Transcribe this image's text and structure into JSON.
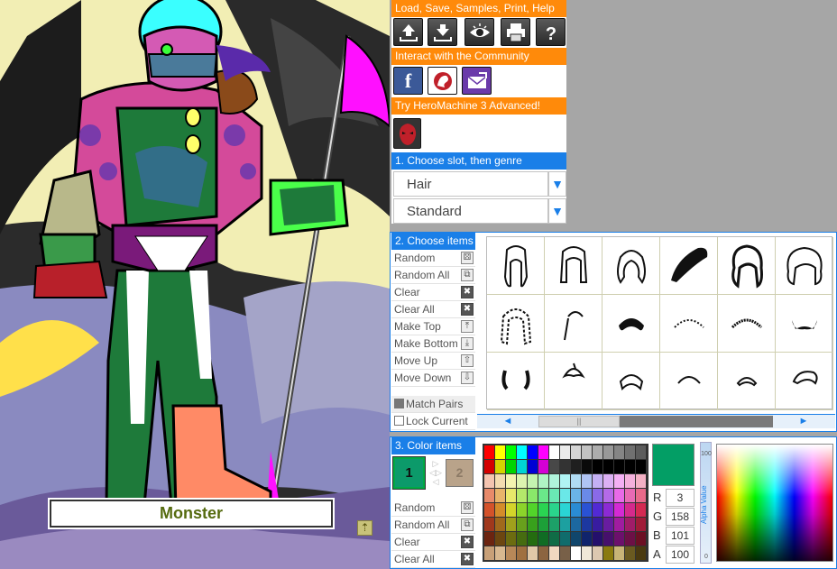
{
  "canvas": {
    "character_name": "Monster",
    "up_arrow_icon": "up-arrow-icon"
  },
  "menu": {
    "header_file": "Load, Save, Samples, Print, Help",
    "file_buttons": [
      {
        "name": "load-icon"
      },
      {
        "name": "save-icon"
      },
      {
        "name": "eye-icon"
      },
      {
        "name": "print-icon"
      },
      {
        "name": "help-icon"
      }
    ],
    "header_community": "Interact with the Community",
    "community_buttons": [
      {
        "name": "facebook-icon",
        "glyph": "f"
      },
      {
        "name": "heromachine-logo-icon"
      },
      {
        "name": "email-icon"
      }
    ],
    "header_advanced": "Try HeroMachine 3 Advanced!",
    "advanced_button": {
      "name": "heromachine3-icon"
    }
  },
  "slot_genre": {
    "header": "1. Choose slot, then genre",
    "slot_value": "Hair",
    "genre_value": "Standard",
    "arrow_glyph": "▼"
  },
  "items": {
    "header": "2. Choose items",
    "actions": [
      {
        "label": "Random",
        "icon": "dice-icon",
        "glyph": "⚄"
      },
      {
        "label": "Random All",
        "icon": "multi-dice-icon",
        "glyph": "⧉"
      },
      {
        "label": "Clear",
        "icon": "clear-icon",
        "glyph": "✖"
      },
      {
        "label": "Clear All",
        "icon": "clear-all-icon",
        "glyph": "✖"
      },
      {
        "label": "Make Top",
        "icon": "make-top-icon",
        "glyph": "⤒"
      },
      {
        "label": "Make Bottom",
        "icon": "make-bottom-icon",
        "glyph": "⤓"
      },
      {
        "label": "Move Up",
        "icon": "move-up-icon",
        "glyph": "⇧"
      },
      {
        "label": "Move Down",
        "icon": "move-down-icon",
        "glyph": "⇩"
      }
    ],
    "match_pairs": "Match Pairs",
    "lock_current": "Lock Current",
    "scroll_left": "◄",
    "scroll_right": "►",
    "scroll_grip": "||"
  },
  "colors": {
    "header": "3. Color items",
    "slot1": "1",
    "slot2": "2",
    "actions": [
      {
        "label": "Random",
        "icon": "dice-icon",
        "glyph": "⚄"
      },
      {
        "label": "Random All",
        "icon": "multi-dice-icon",
        "glyph": "⧉"
      },
      {
        "label": "Clear",
        "icon": "clear-icon",
        "glyph": "✖"
      },
      {
        "label": "Clear All",
        "icon": "clear-all-icon",
        "glyph": "✖"
      }
    ],
    "current_hex": "#039e65",
    "r_label": "R",
    "r": "3",
    "g_label": "G",
    "g": "158",
    "b_label": "B",
    "b": "101",
    "a_label": "A",
    "a": "100",
    "alpha_label": "Alpha Value",
    "alpha_max": "100",
    "alpha_min": "0",
    "palette": [
      "#ff0000",
      "#ffff00",
      "#00ff00",
      "#00ffff",
      "#0000ff",
      "#ff00ff",
      "#ffffff",
      "#ebebeb",
      "#d6d6d6",
      "#c2c2c2",
      "#adadad",
      "#999999",
      "#858585",
      "#707070",
      "#5c5c5c",
      "#d40000",
      "#d4d400",
      "#00d400",
      "#00d4d4",
      "#0000d4",
      "#d400d4",
      "#484848",
      "#333333",
      "#1f1f1f",
      "#0a0a0a",
      "#000000",
      "#000000",
      "#000000",
      "#000000",
      "#000000",
      "#f4c4b0",
      "#f4dcb0",
      "#f4f4b0",
      "#dcf4b0",
      "#c4f4b0",
      "#b0f4c4",
      "#b0f4dc",
      "#b0f4f4",
      "#b0dcf4",
      "#b0c4f4",
      "#c4b0f4",
      "#dcb0f4",
      "#f4b0f4",
      "#f4b0dc",
      "#f4b0c4",
      "#e88a6a",
      "#e8b46a",
      "#e8e86a",
      "#b4e86a",
      "#8ae86a",
      "#6ae88a",
      "#6ae8b4",
      "#6ae8e8",
      "#6ab4e8",
      "#6a8ae8",
      "#8a6ae8",
      "#b46ae8",
      "#e86ae8",
      "#e86ab4",
      "#e86a8a",
      "#d4522a",
      "#d48c2a",
      "#d4d42a",
      "#8cd42a",
      "#52d42a",
      "#2ad452",
      "#2ad48c",
      "#2ad4d4",
      "#2a8cd4",
      "#2a52d4",
      "#522ad4",
      "#8c2ad4",
      "#d42ad4",
      "#d42a8c",
      "#d42a52",
      "#a0381c",
      "#a0681c",
      "#a0a01c",
      "#68a01c",
      "#38a01c",
      "#1ca038",
      "#1ca068",
      "#1ca0a0",
      "#1c68a0",
      "#1c38a0",
      "#381ca0",
      "#681ca0",
      "#a01ca0",
      "#a01c68",
      "#a01c38",
      "#6c2410",
      "#6c4610",
      "#6c6c10",
      "#466c10",
      "#246c10",
      "#106c24",
      "#106c46",
      "#106c6c",
      "#10466c",
      "#10246c",
      "#24106c",
      "#46106c",
      "#6c106c",
      "#6c1046",
      "#6c1024",
      "#c8a078",
      "#d8b890",
      "#b88858",
      "#a07040",
      "#e0c8a8",
      "#8c6440",
      "#f0d8c0",
      "#786048",
      "#ffffff",
      "#f0e8d8",
      "#dcc8b0",
      "#8a7a10",
      "#c8b478",
      "#6a5a20",
      "#4a3a10"
    ]
  }
}
